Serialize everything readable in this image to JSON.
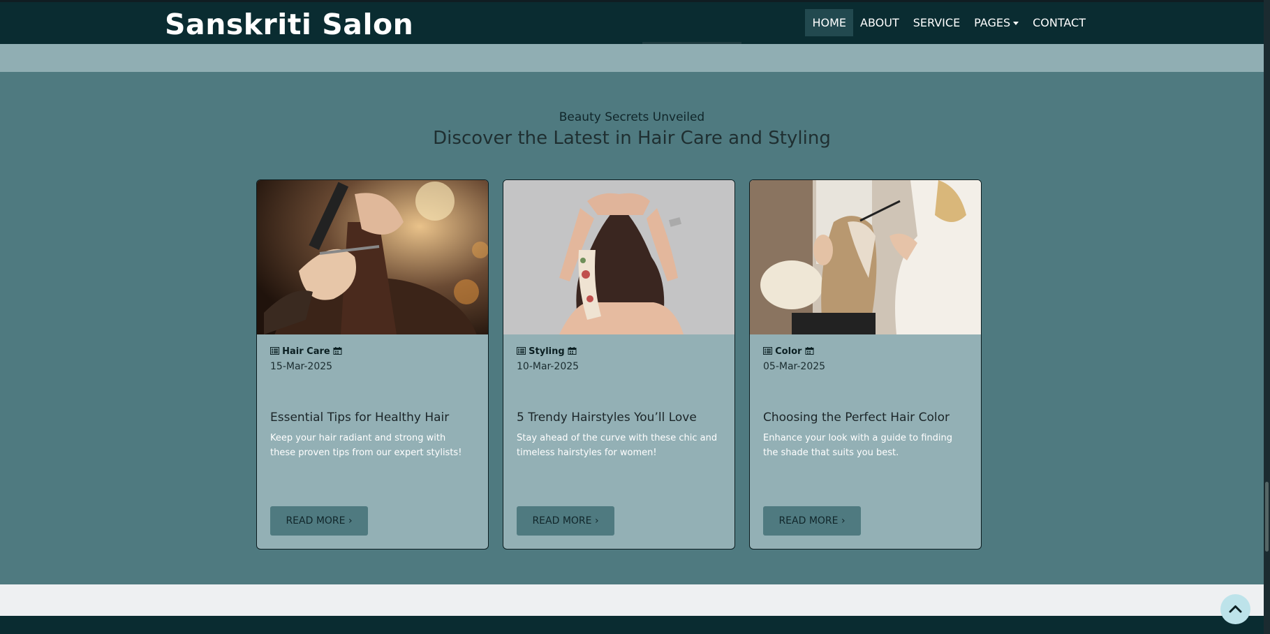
{
  "brand": "Sanskriti Salon",
  "nav": {
    "home": "HOME",
    "about": "ABOUT",
    "service": "SERVICE",
    "pages": "PAGES",
    "contact": "CONTACT"
  },
  "section": {
    "eyebrow": "Beauty Secrets Unveiled",
    "heading": "Discover the Latest in Hair Care and Styling"
  },
  "cards": [
    {
      "category": "Hair Care",
      "date": "15-Mar-2025",
      "title": "Essential Tips for Healthy Hair",
      "text": "Keep your hair radiant and strong with these proven tips from our expert stylists!",
      "button": "READ MORE ›"
    },
    {
      "category": "Styling",
      "date": "10-Mar-2025",
      "title": "5 Trendy Hairstyles You’ll Love",
      "text": "Stay ahead of the curve with these chic and timeless hairstyles for women!",
      "button": "READ MORE ›"
    },
    {
      "category": "Color",
      "date": "05-Mar-2025",
      "title": "Choosing the Perfect Hair Color",
      "text": "Enhance your look with a guide to finding the shade that suits you best.",
      "button": "READ MORE ›"
    }
  ],
  "colors": {
    "navbar": "#0a2c31",
    "section": "#4f7a80",
    "card": "#93b0b5",
    "band": "#90aeb3",
    "totop": "#bde3ea"
  },
  "icons": [
    "list-icon",
    "calendar-icon",
    "chevron-up-icon",
    "chevron-right-icon",
    "caret-down-icon"
  ]
}
